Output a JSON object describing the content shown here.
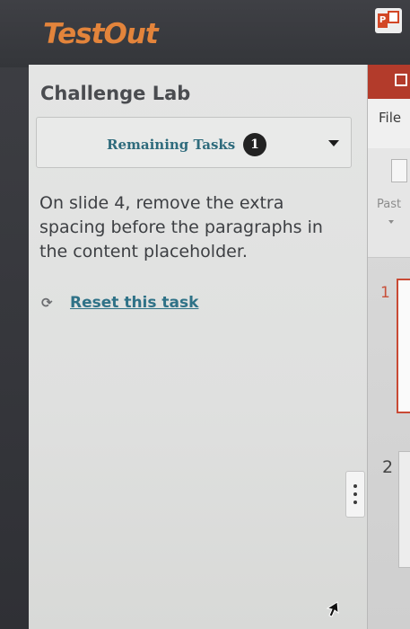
{
  "header": {
    "brand": "TestOut",
    "app_icon": "powerpoint-icon"
  },
  "lab": {
    "title": "Challenge Lab",
    "remaining_tasks_label": "Remaining Tasks",
    "remaining_tasks_count": "1",
    "task_text": "On slide 4, remove the extra spacing before the paragraphs in the content placeholder.",
    "reset_label": "Reset this task"
  },
  "powerpoint": {
    "file_tab": "File",
    "paste_label": "Past",
    "slide_numbers": [
      "1",
      "2"
    ]
  },
  "colors": {
    "brand": "#e3843b",
    "link": "#2f7287",
    "ribbon": "#b33b2b"
  }
}
